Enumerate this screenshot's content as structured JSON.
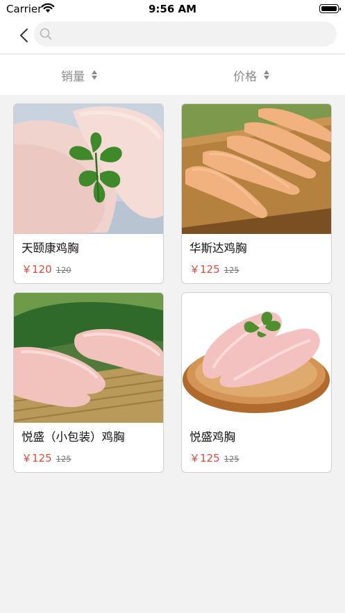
{
  "status_bar": {
    "carrier": "Carrier",
    "time": "9:56 AM"
  },
  "search": {
    "placeholder": "",
    "value": ""
  },
  "sort_bar": {
    "sales_label": "销量",
    "price_label": "价格"
  },
  "products": [
    {
      "name": "天颐康鸡胸",
      "price": "￥120",
      "original_price": "120"
    },
    {
      "name": "华斯达鸡胸",
      "price": "￥125",
      "original_price": "125"
    },
    {
      "name": "悦盛（小包装）鸡胸",
      "price": "￥125",
      "original_price": "125"
    },
    {
      "name": "悦盛鸡胸",
      "price": "￥125",
      "original_price": "125"
    }
  ]
}
